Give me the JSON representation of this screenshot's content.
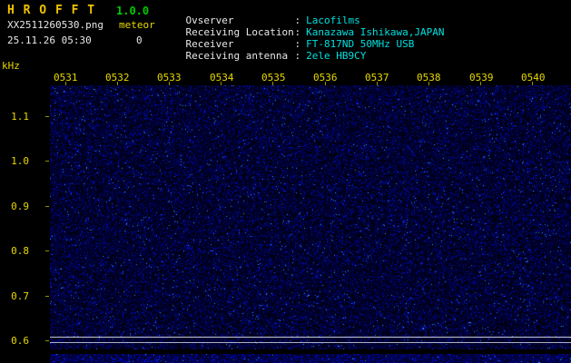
{
  "app": {
    "title": "H R O F F T",
    "version": "1.0.0"
  },
  "capture": {
    "filename": "XX2511260530.png",
    "mode": "meteor",
    "datetime": "25.11.26 05:30",
    "count": "0"
  },
  "observer_info": {
    "rows": [
      {
        "label": "Ovserver",
        "sep": ":",
        "value": "Lacofilms"
      },
      {
        "label": "Receiving Location",
        "sep": ":",
        "value": "Kanazawa Ishikawa,JAPAN"
      },
      {
        "label": "Receiver",
        "sep": ":",
        "value": "FT-817ND 50MHz USB"
      },
      {
        "label": "Receiving antenna",
        "sep": ":",
        "value": "2ele HB9CY"
      }
    ]
  },
  "chart_data": {
    "type": "heatmap",
    "title": "HROFFT 10-minute radio meteor observation spectrogram",
    "x_tick_labels": [
      "0531",
      "0532",
      "0533",
      "0534",
      "0535",
      "0536",
      "0537",
      "0538",
      "0539",
      "0540"
    ],
    "x_range": [
      "0530",
      "0540"
    ],
    "y_unit_label": "kHz",
    "y_tick_labels": [
      "1.1",
      "1.0",
      "0.9",
      "0.8",
      "0.7",
      "0.6"
    ],
    "y_range_khz": [
      0.58,
      1.17
    ],
    "grid": "off",
    "legend": "none",
    "meteor_count": 0,
    "content_summary": "uniform dark-blue background noise speckle, no meteor echo traces; two horizontal reference lines near 0.60-0.61 kHz; separate thin noise-level strip along the bottom edge",
    "reference_lines_khz": [
      0.61,
      0.6
    ],
    "colors": {
      "background": "#000008",
      "noise_speckle": "#1830e0",
      "axis_text": "#e8d800",
      "title_text": "#f0c400",
      "version_text": "#00cc00",
      "info_value_text": "#00e0e0",
      "reference_line": "#c4c8d6"
    }
  }
}
